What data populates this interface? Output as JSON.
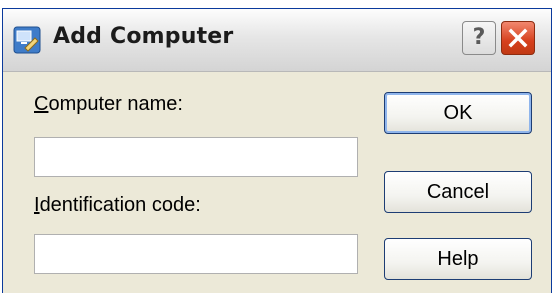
{
  "window": {
    "title": "Add Computer",
    "help_glyph": "?",
    "icons": {
      "app": "add-computer-icon",
      "close": "close-icon"
    }
  },
  "form": {
    "computer_name": {
      "label_underline": "C",
      "label_rest": "omputer name:",
      "value": ""
    },
    "identification_code": {
      "label_underline": "I",
      "label_rest": "dentification code:",
      "value": ""
    }
  },
  "buttons": {
    "ok": "OK",
    "cancel": "Cancel",
    "help": "Help"
  },
  "colors": {
    "close_button": "#d6401d",
    "default_button_border": "#8fb5ec",
    "dialog_bg": "#ece9d8"
  }
}
